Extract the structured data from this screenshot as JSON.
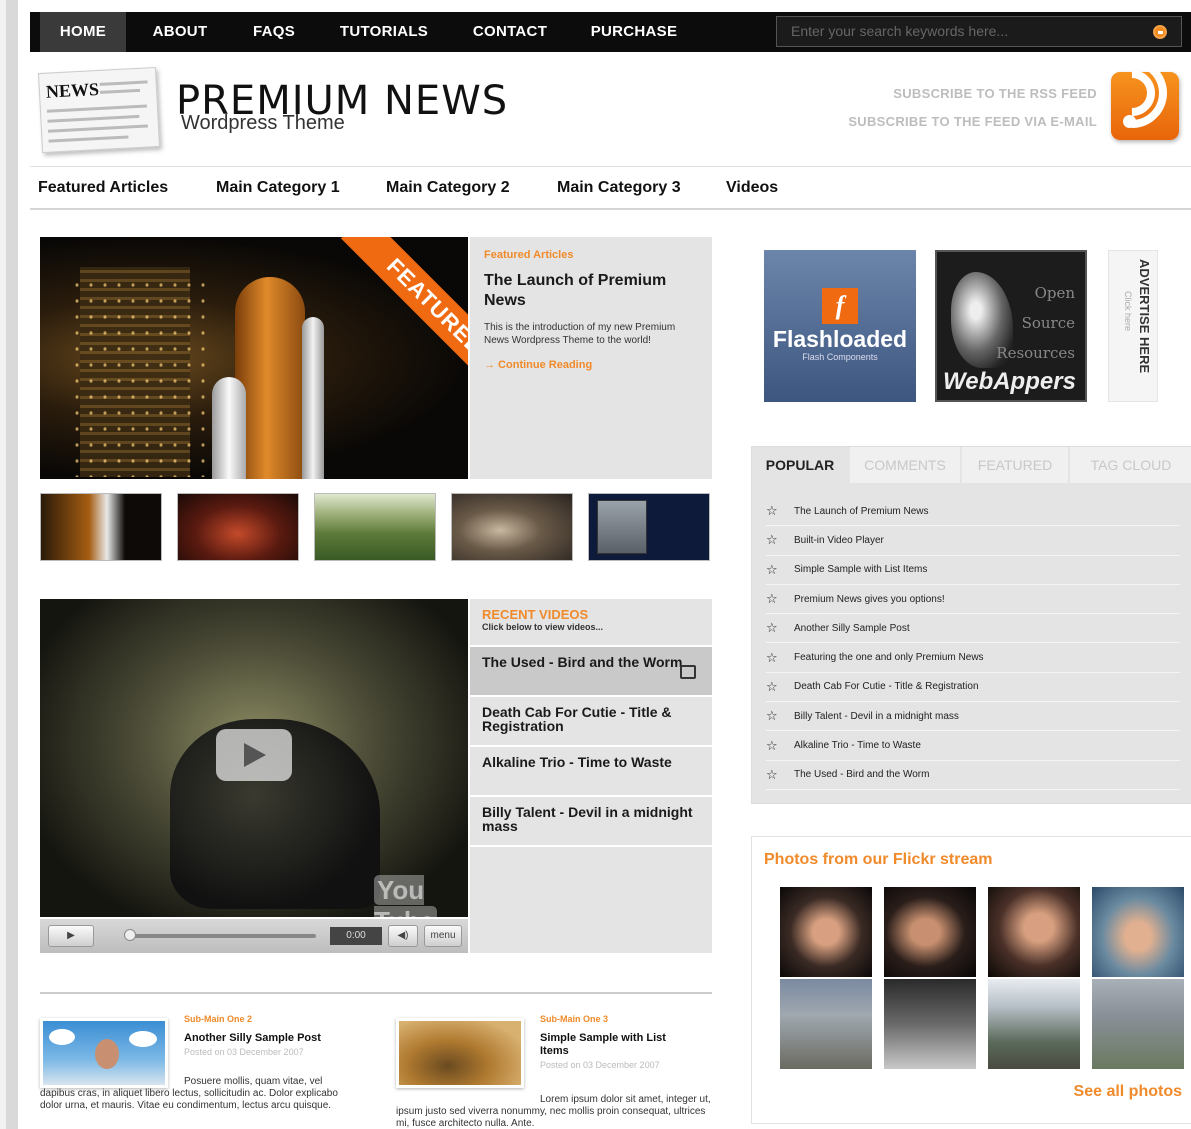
{
  "topnav": {
    "items": [
      "HOME",
      "ABOUT",
      "FAQS",
      "TUTORIALS",
      "CONTACT",
      "PURCHASE"
    ],
    "active": "HOME",
    "search_placeholder": "Enter your search keywords here..."
  },
  "header": {
    "title": "PREMIUM NEWS",
    "subtitle": "Wordpress Theme",
    "logo_text": "NEWS",
    "rss_feed": "SUBSCRIBE TO THE RSS FEED",
    "email_feed": "SUBSCRIBE TO THE FEED VIA E-MAIL"
  },
  "catnav": [
    "Featured Articles",
    "Main Category 1",
    "Main Category 2",
    "Main Category 3",
    "Videos"
  ],
  "featured": {
    "banner": "FEATURED",
    "category": "Featured Articles",
    "title": "The Launch of Premium News",
    "excerpt": "This is the introduction of my new Premium News Wordpress Theme to the world!",
    "more": "→ Continue Reading"
  },
  "videos": {
    "heading": "RECENT VIDEOS",
    "subheading": "Click below to view videos...",
    "items": [
      "The Used - Bird and the Worm",
      "Death Cab For Cutie - Title & Registration",
      "Alkaline Trio - Time to Waste",
      "Billy Talent - Devil in a midnight mass"
    ],
    "time": "0:00",
    "menu_label": "menu",
    "youtube": "You Tube"
  },
  "posts": [
    {
      "category": "Sub-Main One 2",
      "title": "Another Silly Sample Post",
      "date": "Posted on 03 December 2007",
      "text": "Posuere mollis, quam vitae, vel dapibus cras, in aliquet libero lectus, sollicitudin ac. Dolor explicabo dolor urna, et mauris. Vitae eu condimentum, lectus arcu quisque."
    },
    {
      "category": "Sub-Main One 3",
      "title": "Simple Sample with List Items",
      "date": "Posted on 03 December 2007",
      "text": "Lorem ipsum dolor sit amet, integer ut, ipsum justo sed viverra nonummy, nec mollis proin consequat, ultrices mi, fusce architecto nulla. Ante."
    }
  ],
  "ads": {
    "flash_name": "Flashloaded",
    "flash_sub": "Flash Components",
    "web_os": [
      "Open",
      "Source",
      "Resources"
    ],
    "web_brand": "WebAppers",
    "advertise": "ADVERTISE HERE",
    "advertise_sub": "Click here"
  },
  "tabs": {
    "labels": [
      "POPULAR",
      "COMMENTS",
      "FEATURED",
      "TAG CLOUD"
    ],
    "active": "POPULAR",
    "items": [
      "The Launch of Premium News",
      "Built-in Video Player",
      "Simple Sample with List Items",
      "Premium News gives you options!",
      "Another Silly Sample Post",
      "Featuring the one and only Premium News",
      "Death Cab For Cutie - Title & Registration",
      "Billy Talent - Devil in a midnight mass",
      "Alkaline Trio - Time to Waste",
      "The Used - Bird and the Worm"
    ]
  },
  "flickr": {
    "title": "Photos from our Flickr stream",
    "see_all": "See all photos"
  },
  "colors": {
    "accent": "#f08a2a",
    "topbar": "#0c0c0c",
    "panel": "#e4e4e4"
  }
}
